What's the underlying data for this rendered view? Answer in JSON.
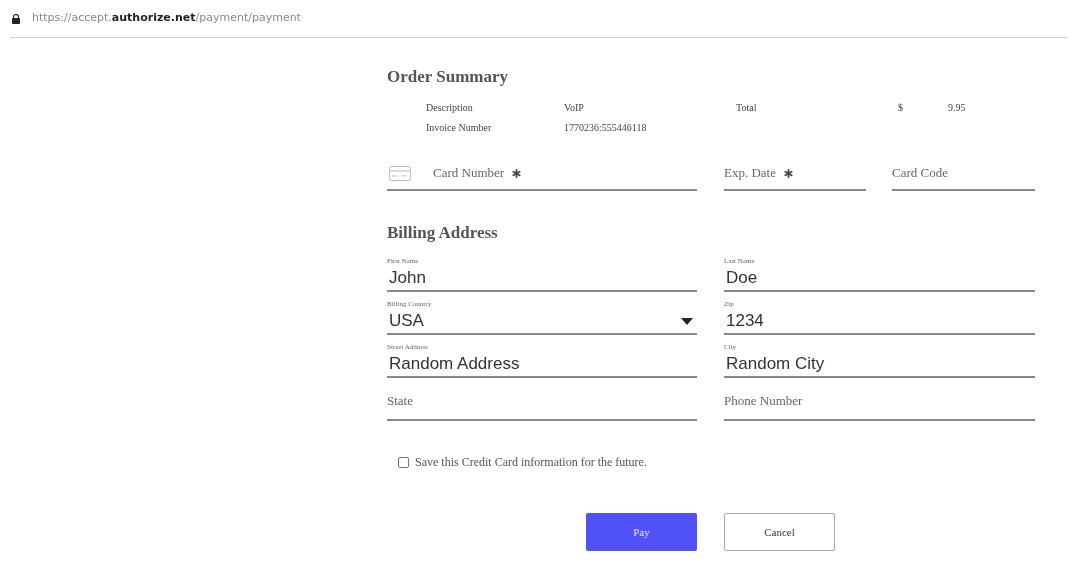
{
  "address_bar": {
    "url": "https://accept.**authorize.net**/payment/payment"
  },
  "order_summary": {
    "title": "Order Summary",
    "rows": [
      {
        "label": "Description",
        "value": "VoIP",
        "total_label": "Total",
        "currency": "$",
        "amount": "9.95"
      },
      {
        "label": "Invoice Number",
        "value": "1770236:555446118"
      }
    ]
  },
  "card_fields": [
    {
      "placeholder": "Card Number",
      "required": true
    },
    {
      "placeholder": "Exp. Date",
      "required": true
    },
    {
      "placeholder": "Card Code",
      "required": false
    }
  ],
  "billing": {
    "title": "Billing Address",
    "fields": [
      {
        "kind": "text",
        "label": "First Name",
        "value": "John"
      },
      {
        "kind": "text",
        "label": "Last Name",
        "value": "Doe"
      },
      {
        "kind": "select",
        "label": "Billing Country",
        "value": "USA"
      },
      {
        "kind": "text",
        "label": "Zip",
        "value": "1234"
      },
      {
        "kind": "text",
        "label": "Street Address",
        "value": "Random Address"
      },
      {
        "kind": "text",
        "label": "City",
        "value": "Random City"
      },
      {
        "kind": "text",
        "placeholder": "State"
      },
      {
        "kind": "text",
        "placeholder": "Phone Number"
      }
    ]
  },
  "save_card": {
    "label": "Save this Credit Card information for the future.",
    "checked": false
  },
  "buttons": [
    {
      "label": "Pay",
      "kind": "primary"
    },
    {
      "label": "Cancel",
      "kind": "secondary"
    }
  ]
}
